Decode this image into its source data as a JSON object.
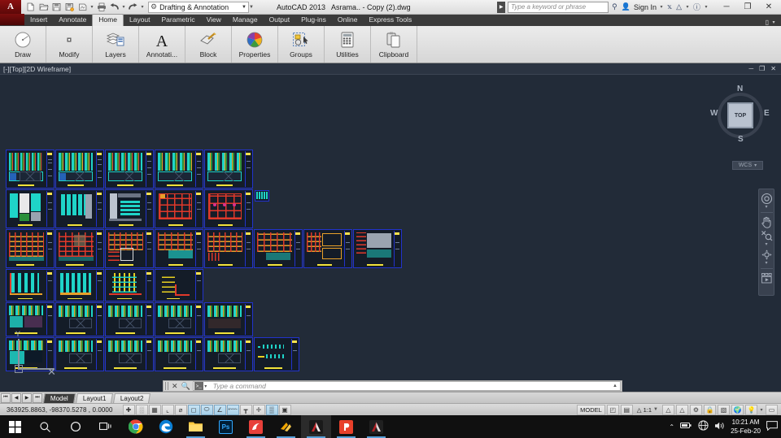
{
  "titlebar": {
    "app_button": "A",
    "quick_access": [
      {
        "name": "new-file-icon",
        "glyph": "⬜"
      },
      {
        "name": "open-file-icon",
        "glyph": "🗁"
      },
      {
        "name": "save-icon",
        "glyph": "💾"
      },
      {
        "name": "save-as-icon",
        "glyph": "💾"
      },
      {
        "name": "plot-preview-icon",
        "glyph": "◨"
      },
      {
        "name": "print-icon",
        "glyph": "🖨"
      },
      {
        "name": "undo-icon",
        "glyph": "↶"
      },
      {
        "name": "redo-icon",
        "glyph": "↷"
      }
    ],
    "workspace": "Drafting & Annotation",
    "app_name": "AutoCAD 2013",
    "document_title": "Asrama.. - Copy (2).dwg",
    "search_placeholder": "Type a keyword or phrase",
    "sign_in": "Sign In",
    "minimize": "─",
    "maximize": "❐",
    "close": "✕"
  },
  "ribbon": {
    "tabs": [
      {
        "label": "Insert",
        "active": false
      },
      {
        "label": "Annotate",
        "active": false
      },
      {
        "label": "Home",
        "active": true
      },
      {
        "label": "Layout",
        "active": false
      },
      {
        "label": "Parametric",
        "active": false
      },
      {
        "label": "View",
        "active": false
      },
      {
        "label": "Manage",
        "active": false
      },
      {
        "label": "Output",
        "active": false
      },
      {
        "label": "Plug-ins",
        "active": false
      },
      {
        "label": "Online",
        "active": false
      },
      {
        "label": "Express Tools",
        "active": false
      }
    ],
    "panels": [
      {
        "label": "Draw",
        "icon": "draw-circle-icon"
      },
      {
        "label": "Modify",
        "icon": "modify-icon"
      },
      {
        "label": "Layers",
        "icon": "layers-icon"
      },
      {
        "label": "Annotati...",
        "icon": "text-annotation-icon"
      },
      {
        "label": "Block",
        "icon": "block-icon"
      },
      {
        "label": "Properties",
        "icon": "properties-color-wheel-icon"
      },
      {
        "label": "Groups",
        "icon": "groups-icon"
      },
      {
        "label": "Utilities",
        "icon": "utilities-calculator-icon"
      },
      {
        "label": "Clipboard",
        "icon": "clipboard-icon"
      }
    ]
  },
  "viewport": {
    "label": "[-][Top][2D Wireframe]",
    "minimize": "─",
    "restore": "❐",
    "close": "✕",
    "viewcube": {
      "top": "TOP",
      "north": "N",
      "south": "S",
      "east": "E",
      "west": "W",
      "wcs": "WCS"
    },
    "navbar": [
      {
        "name": "steering-wheel-icon",
        "glyph": "◎"
      },
      {
        "name": "pan-hand-icon",
        "glyph": "✋"
      },
      {
        "name": "zoom-extents-icon",
        "glyph": "⤡"
      },
      {
        "name": "orbit-icon",
        "glyph": "✥"
      },
      {
        "name": "showmotion-icon",
        "glyph": "▶"
      }
    ],
    "ucs_y_label": "Y"
  },
  "command_line": {
    "close_icon": "✕",
    "settings_icon": "🔍",
    "prompt": ">_",
    "placeholder": "Type a command",
    "expand_icon": "▲"
  },
  "layout_tabs": {
    "nav": [
      "⏮",
      "◀",
      "▶",
      "⏭"
    ],
    "tabs": [
      {
        "label": "Model",
        "active": true
      },
      {
        "label": "Layout1",
        "active": false
      },
      {
        "label": "Layout2",
        "active": false
      }
    ]
  },
  "statusbar": {
    "coordinates": "363925.8863, -98370.5278 , 0.0000",
    "toggles": [
      {
        "name": "infer-constraints-icon",
        "glyph": "✚",
        "on": false
      },
      {
        "name": "snap-mode-icon",
        "glyph": "░",
        "on": false
      },
      {
        "name": "grid-display-icon",
        "glyph": "▦",
        "on": false
      },
      {
        "name": "ortho-mode-icon",
        "glyph": "⌞",
        "on": false
      },
      {
        "name": "polar-tracking-icon",
        "glyph": "⌀",
        "on": false
      },
      {
        "name": "object-snap-icon",
        "glyph": "◻",
        "on": true
      },
      {
        "name": "3d-object-snap-icon",
        "glyph": "⬭",
        "on": true
      },
      {
        "name": "object-snap-tracking-icon",
        "glyph": "∠",
        "on": true
      },
      {
        "name": "dynamic-ucs-icon",
        "glyph": "⬳",
        "on": true
      },
      {
        "name": "dynamic-input-icon",
        "glyph": "┳",
        "on": false
      },
      {
        "name": "lineweight-icon",
        "glyph": "✛",
        "on": false
      },
      {
        "name": "transparency-icon",
        "glyph": "▒",
        "on": true
      },
      {
        "name": "quick-properties-icon",
        "glyph": "▣",
        "on": false
      }
    ],
    "space": "MODEL",
    "scale": "1:1",
    "right_icons": [
      {
        "name": "model-space-icon",
        "glyph": "◰"
      },
      {
        "name": "layout-space-icon",
        "glyph": "▤"
      },
      {
        "name": "annotation-visibility-icon",
        "glyph": "△"
      },
      {
        "name": "annotation-scale-auto-icon",
        "glyph": "△"
      },
      {
        "name": "annotation-scale-change-icon",
        "glyph": "△"
      },
      {
        "name": "workspace-switch-icon",
        "glyph": "⚙"
      },
      {
        "name": "toolbar-lock-icon",
        "glyph": "🔒"
      },
      {
        "name": "hardware-acceleration-icon",
        "glyph": "▧"
      },
      {
        "name": "isolate-objects-icon",
        "glyph": "🌍"
      },
      {
        "name": "clean-screen-icon",
        "glyph": "💡"
      },
      {
        "name": "status-menu-icon",
        "glyph": "▾"
      },
      {
        "name": "fullscreen-icon",
        "glyph": "▭"
      }
    ]
  },
  "taskbar": {
    "items": [
      {
        "name": "start-button",
        "glyph": "⊞",
        "color": "#ffffff",
        "running": false
      },
      {
        "name": "search-icon",
        "glyph": "⌕",
        "color": "#e8e8e8",
        "running": false
      },
      {
        "name": "cortana-icon",
        "glyph": "○",
        "color": "#e8e8e8",
        "running": false
      },
      {
        "name": "task-view-icon",
        "glyph": "⌸",
        "color": "#e8e8e8",
        "running": false
      },
      {
        "name": "chrome-icon",
        "glyph": "",
        "color": "#4285f4",
        "running": false
      },
      {
        "name": "edge-icon",
        "glyph": "e",
        "color": "#0a7fd4",
        "running": false
      },
      {
        "name": "file-explorer-icon",
        "glyph": "📁",
        "color": "#ffc83d",
        "running": true
      },
      {
        "name": "photoshop-icon",
        "glyph": "Ps",
        "color": "#31a8ff",
        "running": false
      },
      {
        "name": "sketchup-icon",
        "glyph": "",
        "color": "#e8403a",
        "running": true
      },
      {
        "name": "lumion-icon",
        "glyph": "",
        "color": "#f0a500",
        "running": true
      },
      {
        "name": "autocad-icon",
        "glyph": "A",
        "color": "#c0252a",
        "running": true,
        "active": true
      },
      {
        "name": "pdf-reader-icon",
        "glyph": "",
        "color": "#e8402a",
        "running": true
      },
      {
        "name": "autocad-second-icon",
        "glyph": "A",
        "color": "#b01f24",
        "running": true
      }
    ],
    "tray": [
      {
        "name": "show-hidden-icons",
        "glyph": "⌃"
      },
      {
        "name": "battery-icon",
        "glyph": "🔋"
      },
      {
        "name": "network-icon",
        "glyph": "🌐"
      },
      {
        "name": "volume-icon",
        "glyph": "🔊"
      }
    ],
    "clock_time": "10:21 AM",
    "clock_date": "25-Feb-20",
    "action_center": "💬"
  },
  "drawing": {
    "description": "Architectural DWG sheet set arranged in a grid of title-blocked drawings",
    "sheet_rows": 6,
    "accent_border": "#2233cc",
    "background": "#222b38"
  }
}
